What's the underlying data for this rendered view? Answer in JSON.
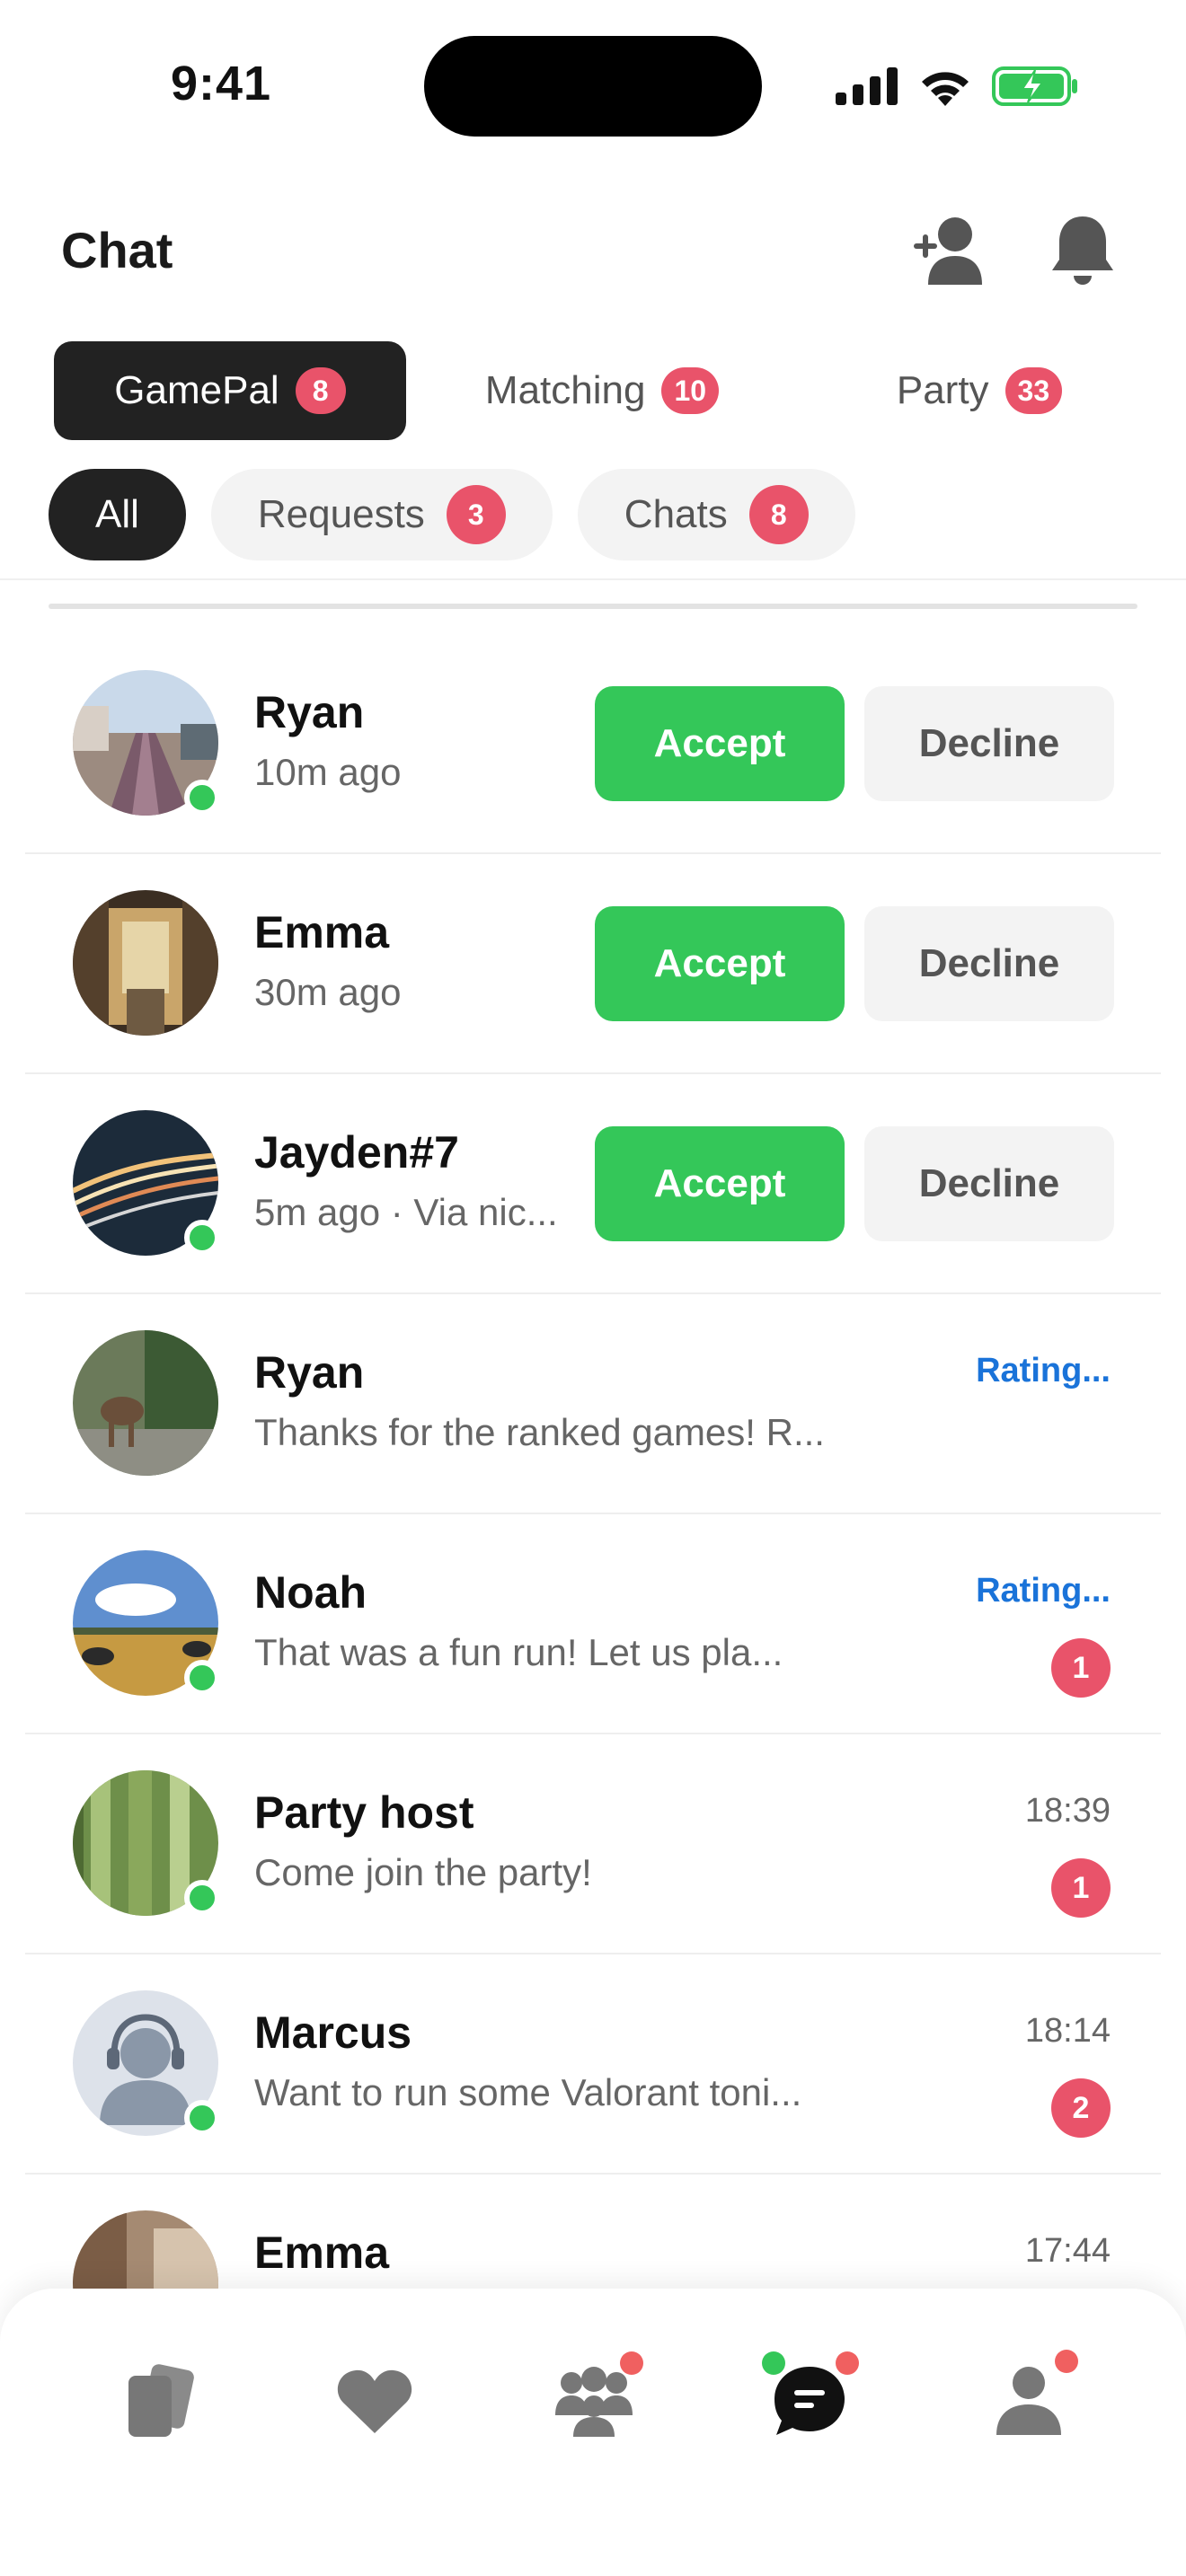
{
  "status": {
    "time": "9:41"
  },
  "header": {
    "title": "Chat"
  },
  "tabs": [
    {
      "label": "GamePal",
      "count": "8",
      "active": true
    },
    {
      "label": "Matching",
      "count": "10",
      "active": false
    },
    {
      "label": "Party",
      "count": "33",
      "active": false
    }
  ],
  "chips": [
    {
      "label": "All",
      "count": "",
      "active": true
    },
    {
      "label": "Requests",
      "count": "3",
      "active": false
    },
    {
      "label": "Chats",
      "count": "8",
      "active": false
    }
  ],
  "requests": [
    {
      "name": "Ryan",
      "sub": "10m ago",
      "online": true,
      "accept": "Accept",
      "decline": "Decline"
    },
    {
      "name": "Emma",
      "sub": "30m ago",
      "online": false,
      "accept": "Accept",
      "decline": "Decline"
    },
    {
      "name": "Jayden#7",
      "sub": "5m ago · Via nic...",
      "online": true,
      "accept": "Accept",
      "decline": "Decline"
    }
  ],
  "chats": [
    {
      "name": "Ryan",
      "preview": "Thanks for the ranked games! R...",
      "meta": "Rating...",
      "meta_link": true,
      "unread": "",
      "online": false
    },
    {
      "name": "Noah",
      "preview": "That was a fun run! Let us pla...",
      "meta": "Rating...",
      "meta_link": true,
      "unread": "1",
      "online": true
    },
    {
      "name": "Party host",
      "preview": "Come join the party!",
      "meta": "18:39",
      "meta_link": false,
      "unread": "1",
      "online": true
    },
    {
      "name": "Marcus",
      "preview": "Want to run some Valorant toni...",
      "meta": "18:14",
      "meta_link": false,
      "unread": "2",
      "online": true
    },
    {
      "name": "Emma",
      "preview": "",
      "meta": "17:44",
      "meta_link": false,
      "unread": "",
      "online": false
    }
  ],
  "nav": [
    {
      "icon": "cards-icon",
      "dot": ""
    },
    {
      "icon": "heart-icon",
      "dot": ""
    },
    {
      "icon": "group-icon",
      "dot": "red"
    },
    {
      "icon": "chat-icon",
      "dot": "both",
      "active": true
    },
    {
      "icon": "profile-icon",
      "dot": "red"
    }
  ],
  "colors": {
    "accent_green": "#34c759",
    "badge_red": "#e9536a",
    "link_blue": "#1a73d9"
  }
}
